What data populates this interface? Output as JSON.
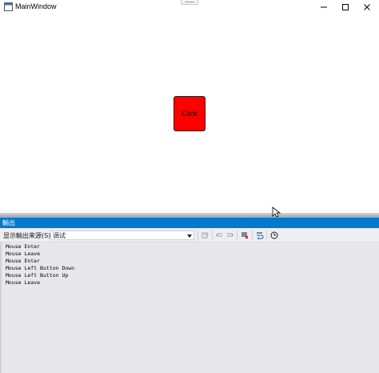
{
  "window": {
    "title": "MainWindow",
    "controls": [
      "minimize-icon",
      "maximize-icon",
      "close-icon"
    ]
  },
  "main": {
    "button_label": "Click",
    "button_color": "#ff0000"
  },
  "output": {
    "panel_title": "輸出",
    "source_label": "显示輸出来源(S):",
    "source_value": "调试",
    "header_color": "#007acc",
    "lines": [
      "Mouse Enter",
      "Mouse Leave",
      "Mouse Enter",
      "Mouse Left Button Down",
      "Mouse Left Button Up",
      "Mouse Leave"
    ],
    "toolbar_icons": [
      "find-previous-icon",
      "go-previous-icon",
      "go-next-icon",
      "clear-all-icon",
      "toggle-word-wrap-icon",
      "clock-icon"
    ]
  }
}
